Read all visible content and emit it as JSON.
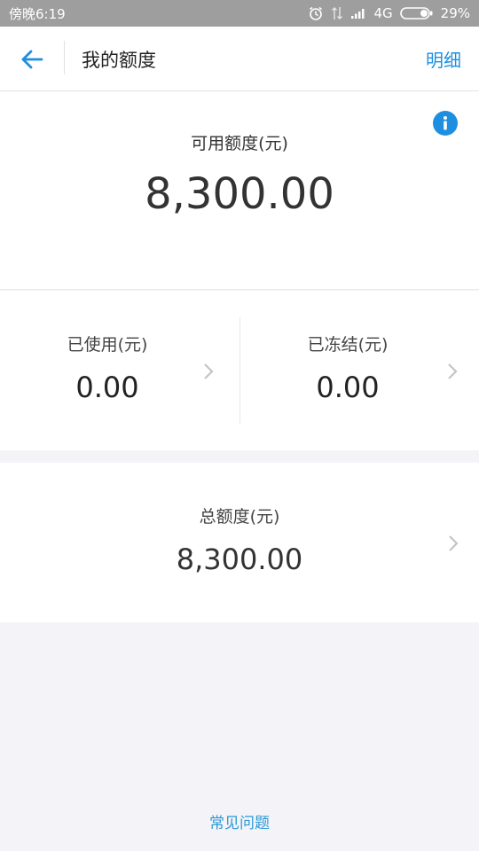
{
  "status_bar": {
    "time": "傍晚6:19",
    "network": "4G",
    "battery": "29%",
    "icons": [
      "alarm-icon",
      "data-transfer-icon",
      "signal-icon",
      "battery-icon"
    ]
  },
  "header": {
    "title": "我的额度",
    "action": "明细",
    "back_icon": "arrow-left-icon"
  },
  "available": {
    "label": "可用额度(元)",
    "amount": "8,300.00",
    "info_icon": "info-icon"
  },
  "used": {
    "label": "已使用(元)",
    "value": "0.00"
  },
  "frozen": {
    "label": "已冻结(元)",
    "value": "0.00"
  },
  "total": {
    "label": "总额度(元)",
    "value": "8,300.00"
  },
  "faq": {
    "label": "常见问题"
  },
  "colors": {
    "accent": "#1e8fe0",
    "status_bar": "#9e9e9e",
    "background": "#f4f3f8"
  }
}
